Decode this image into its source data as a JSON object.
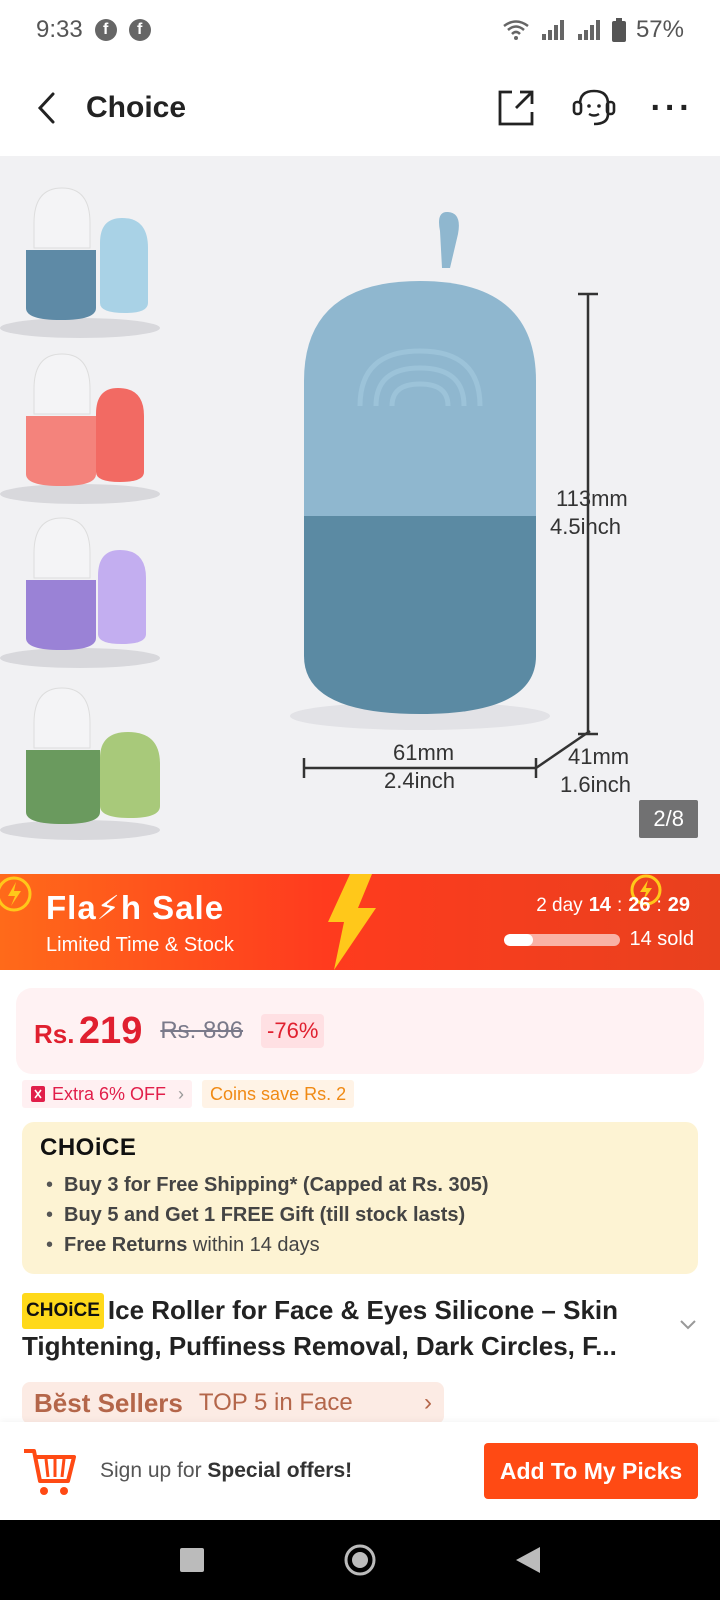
{
  "status_bar": {
    "time": "9:33",
    "battery": "57%",
    "app_badge": "f"
  },
  "header": {
    "title": "Choice"
  },
  "gallery": {
    "counter": "2/8",
    "dimension_height_mm": "113mm",
    "dimension_height_in": "4.5inch",
    "dimension_width_mm": "61mm",
    "dimension_width_in": "2.4inch",
    "dimension_depth_mm": "41mm",
    "dimension_depth_in": "1.6inch",
    "thumb_colors": [
      "#5e8aa6",
      "#f06a64",
      "#9a82d6",
      "#6a9a5e"
    ],
    "thumb_colors_back": [
      "#a9d2e6",
      "#f26a63",
      "#c3aef0",
      "#a8c97a"
    ]
  },
  "flash_sale": {
    "title": "Fla⚡h Sale",
    "subtitle": "Limited Time & Stock",
    "days": "2 day",
    "hours": "14",
    "minutes": "26",
    "seconds": "29",
    "sold": "14 sold",
    "sold_progress": 0.25
  },
  "price": {
    "currency": "Rs.",
    "current": "219",
    "original": "Rs. 896",
    "discount": "-76%"
  },
  "promos": {
    "extra": "Extra 6% OFF",
    "coins": "Coins save Rs. 2"
  },
  "choice": {
    "logo": "CHOiCE",
    "items": [
      {
        "bold": "Buy 3 for  Free Shipping* (Capped at Rs. 305)",
        "rest": ""
      },
      {
        "bold": "Buy 5 and Get 1 FREE Gift (till stock lasts)",
        "rest": ""
      },
      {
        "bold": "Free Returns",
        "rest": " within 14 days"
      }
    ]
  },
  "product": {
    "badge": "CHOiCE",
    "title": "Ice Roller for Face & Eyes Silicone – Skin Tightening, Puffiness Removal, Dark Circles, F..."
  },
  "best_sellers": {
    "label": "Bĕst Sellers",
    "value": "TOP 5 in Face"
  },
  "bottom_bar": {
    "signup_prefix": "Sign up for ",
    "signup_bold": "Special offers!",
    "cta": "Add To My Picks"
  },
  "colors": {
    "accent": "#ff4a14",
    "price_red": "#e0202f",
    "choice_bg": "#fdf3d3"
  }
}
